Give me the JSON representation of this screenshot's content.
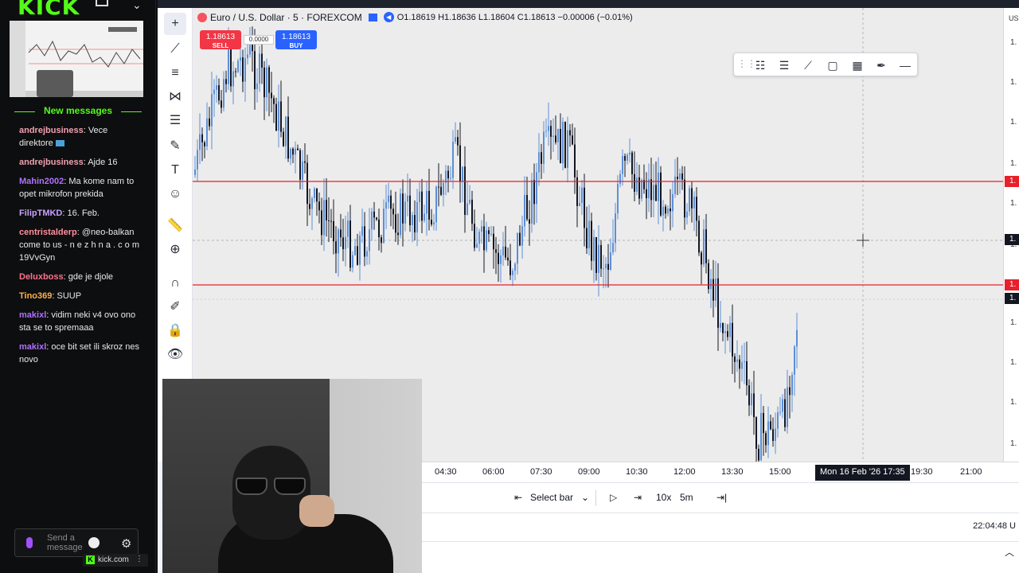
{
  "kick": {
    "logo": "KICK",
    "new_messages": "New messages",
    "chat_placeholder": "Send a message",
    "url": "kick.com",
    "messages": [
      {
        "user": "andrejbusiness",
        "user_color": "#f0a0b0",
        "text": "Vece direktore",
        "badge": true
      },
      {
        "user": "andrejbusiness",
        "user_color": "#f0a0b0",
        "text": "Ajde 16",
        "badge": false
      },
      {
        "user": "Mahin2002",
        "user_color": "#b070ff",
        "text": "Ma kome nam to opet mikrofon prekida",
        "badge": false
      },
      {
        "user": "FilipTMKD",
        "user_color": "#c8a0ff",
        "text": "16. Feb.",
        "badge": false
      },
      {
        "user": "centristalderp",
        "user_color": "#ff90a0",
        "text": "@neo-balkan come to us - n e z h n a . c o m 19VvGyn",
        "badge": false
      },
      {
        "user": "Deluxboss",
        "user_color": "#ff7090",
        "text": "gde je djole",
        "badge": false
      },
      {
        "user": "Tino369",
        "user_color": "#ffb050",
        "text": "SUUP",
        "badge": false
      },
      {
        "user": "makixl",
        "user_color": "#b070ff",
        "text": "vidim neki v4 ovo ono sta se to spremaaa",
        "badge": false
      },
      {
        "user": "makixl",
        "user_color": "#b070ff",
        "text": "oce bit set ili skroz nes novo",
        "badge": false
      }
    ]
  },
  "chart": {
    "symbol": "Euro / U.S. Dollar · 5 · FOREXCOM",
    "ohlc": "O1.18619 H1.18636 L1.18604 C1.18613 −0.00006 (−0.01%)",
    "sell": {
      "price": "1.18613",
      "label": "SELL"
    },
    "buy": {
      "price": "1.18613",
      "label": "BUY"
    },
    "spread": "0.0000",
    "currency": "USD",
    "price_labels": [
      "1.",
      "1.",
      "1.",
      "1.",
      "1.",
      "1.",
      "1.",
      "1.",
      "1.",
      "1.",
      "1."
    ],
    "tag_labels": [
      "1.",
      "1.",
      "1.",
      "1."
    ],
    "time_labels": [
      "04:30",
      "06:00",
      "07:30",
      "09:00",
      "10:30",
      "12:00",
      "13:30",
      "15:00",
      "19:30",
      "21:00"
    ],
    "cursor_time": "Mon 16 Feb '26   17:35",
    "colors": {
      "up": "#5b8fd9",
      "down": "#131722",
      "hline": "#e8202a",
      "bg": "#ececec"
    }
  },
  "replay": {
    "select_bar": "Select bar",
    "speed": "10x",
    "interval": "5m"
  },
  "clock": "22:04:48 U"
}
